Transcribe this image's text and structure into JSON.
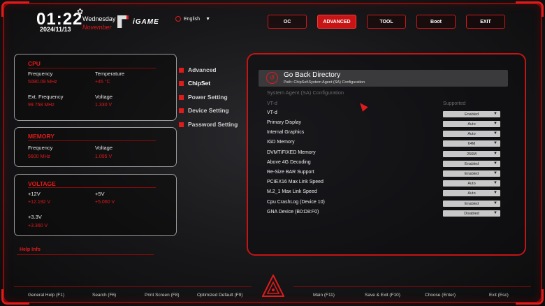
{
  "header": {
    "time": "01:22",
    "weekday": "Wednesday",
    "month": "November",
    "date": "2024/11/13",
    "brand": "iGAME",
    "language": "English"
  },
  "topnav": [
    {
      "label": "OC",
      "active": false
    },
    {
      "label": "ADVANCED",
      "active": true
    },
    {
      "label": "TOOL",
      "active": false
    },
    {
      "label": "Boot",
      "active": false
    },
    {
      "label": "EXIT",
      "active": false
    }
  ],
  "cpu": {
    "title": "CPU",
    "frequency_label": "Frequency",
    "frequency_value": "5080.09 MHz",
    "temperature_label": "Temperature",
    "temperature_value": "+45 °C",
    "ext_freq_label": "Ext. Frequency",
    "ext_freq_value": "99.758 MHz",
    "voltage_label": "Voltage",
    "voltage_value": "1.330 V"
  },
  "memory": {
    "title": "MEMORY",
    "frequency_label": "Frequency",
    "frequency_value": "5600 MHz",
    "voltage_label": "Voltage",
    "voltage_value": "1.095 V"
  },
  "voltage": {
    "title": "VOLTAGE",
    "v12_label": "+12V",
    "v12_value": "+12.192 V",
    "v5_label": "+5V",
    "v5_value": "+5.060 V",
    "v33_label": "+3.3V",
    "v33_value": "+3.360 V"
  },
  "help_info": "Help Info",
  "menu": [
    {
      "label": "Advanced",
      "active": false
    },
    {
      "label": "ChipSet",
      "active": true
    },
    {
      "label": "Power Setting",
      "active": false
    },
    {
      "label": "Device Setting",
      "active": false
    },
    {
      "label": "Password Setting",
      "active": false
    }
  ],
  "settings": {
    "go_back_title": "Go Back Directory",
    "path": "Path: ChipSet\\System Agent (SA) Configuration",
    "section_title": "System Agent (SA) Configuration",
    "vtd_label": "VT-d",
    "vtd_value": "Supported",
    "rows": [
      {
        "label": "VT-d",
        "value": "Enabled"
      },
      {
        "label": "Primary Display",
        "value": "Auto"
      },
      {
        "label": "Internal Graphics",
        "value": "Auto"
      },
      {
        "label": "IGD Memory",
        "value": "64M"
      },
      {
        "label": "DVMT/FIXED Memory",
        "value": "256M"
      },
      {
        "label": "Above 4G Decoding",
        "value": "Enabled"
      },
      {
        "label": "Re-Size BAR Support",
        "value": "Enabled"
      },
      {
        "label": "PCIEX16 Max Link Speed",
        "value": "Auto"
      },
      {
        "label": "M.2_1 Max Link Speed",
        "value": "Auto"
      },
      {
        "label": "Cpu CrashLog (Device 10)",
        "value": "Enabled"
      },
      {
        "label": "GNA Device (B0:D8:F0)",
        "value": "Disabled"
      }
    ]
  },
  "footer": [
    "General Help (F1)",
    "Search (F6)",
    "Print Screen (F8)",
    "Optimized Default (F9)",
    "Main (F11)",
    "Save & Exit (F10)",
    "Choose (Enter)",
    "Exit (Esc)"
  ],
  "colors": {
    "accent": "#e11a1a",
    "panel_border": "#9a9a9a",
    "background": "#161618"
  }
}
